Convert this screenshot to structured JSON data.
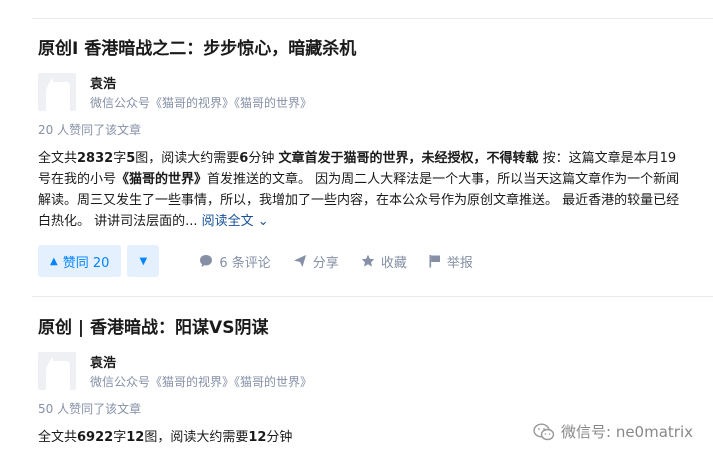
{
  "articles": [
    {
      "title": "原创I 香港暗战之二：步步惊心，暗藏杀机",
      "author_name": "袁浩",
      "author_desc": "微信公众号《猫哥的视界》《猫哥的世界》",
      "vote_info": "20 人赞同了该文章",
      "excerpt": {
        "p1": "全文共",
        "b1": "2832",
        "p2": "字",
        "b2": "5",
        "p3": "图，阅读大约需要",
        "b3": "6",
        "p4": "分钟 ",
        "b4": "文章首发于猫哥的世界，未经授权，不得转载",
        "p5": " 按：这篇文章是本月19号在我的小号",
        "b5": "《猫哥的世界》",
        "p6": "首发推送的文章。 因为周二人大释法是一个大事，所以当天这篇文章作为一个新闻解读。周三又发生了一些事情，所以，我增加了一些内容，在本公众号作为原创文章推送。 最近香港的较量已经白热化。 讲讲司法层面的...",
        "read_more": "阅读全文 ⌄"
      },
      "upvote_label": "赞同 20",
      "comments_label": "6 条评论",
      "share_label": "分享",
      "collect_label": "收藏",
      "report_label": "举报"
    },
    {
      "title": "原创 | 香港暗战：阳谋VS阴谋",
      "author_name": "袁浩",
      "author_desc": "微信公众号《猫哥的视界》《猫哥的世界》",
      "vote_info": "50 人赞同了该文章",
      "excerpt": {
        "p1": "全文共",
        "b1": "6922",
        "p2": "字",
        "b2": "12",
        "p3": "图，阅读大约需要",
        "b3": "12",
        "p4": "分钟"
      }
    }
  ],
  "watermark": "微信号: ne0matrix",
  "colors": {
    "accent": "#0084ff",
    "accent_bg": "#e5f0ff",
    "muted": "#8590a6",
    "link": "#175199"
  }
}
